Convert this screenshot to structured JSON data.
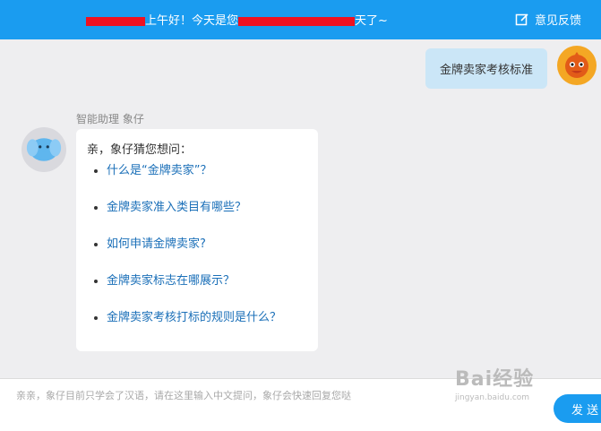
{
  "header": {
    "greeting_part1": "上午好！今天是您",
    "greeting_part2": "天了~",
    "feedback_label": "意见反馈"
  },
  "chat": {
    "user_message": "金牌卖家考核标准",
    "bot_name": "智能助理 象仔",
    "bot_intro": "亲，象仔猜您想问：",
    "suggestions": [
      "什么是“金牌卖家”？",
      "金牌卖家准入类目有哪些？",
      "如何申请金牌卖家?",
      "金牌卖家标志在哪展示？",
      "金牌卖家考核打标的规则是什么？"
    ]
  },
  "input": {
    "placeholder": "亲亲，象仔目前只学会了汉语，请在这里输入中文提问，象仔会快速回复您哒",
    "send_label": "发 送"
  },
  "watermark": {
    "main": "Bai经验",
    "sub": "jingyan.baidu.com"
  },
  "colors": {
    "header": "#1a9cf0",
    "user_bubble": "#cbe6f7",
    "link": "#1a6fb8",
    "redaction": "#ee1122"
  }
}
